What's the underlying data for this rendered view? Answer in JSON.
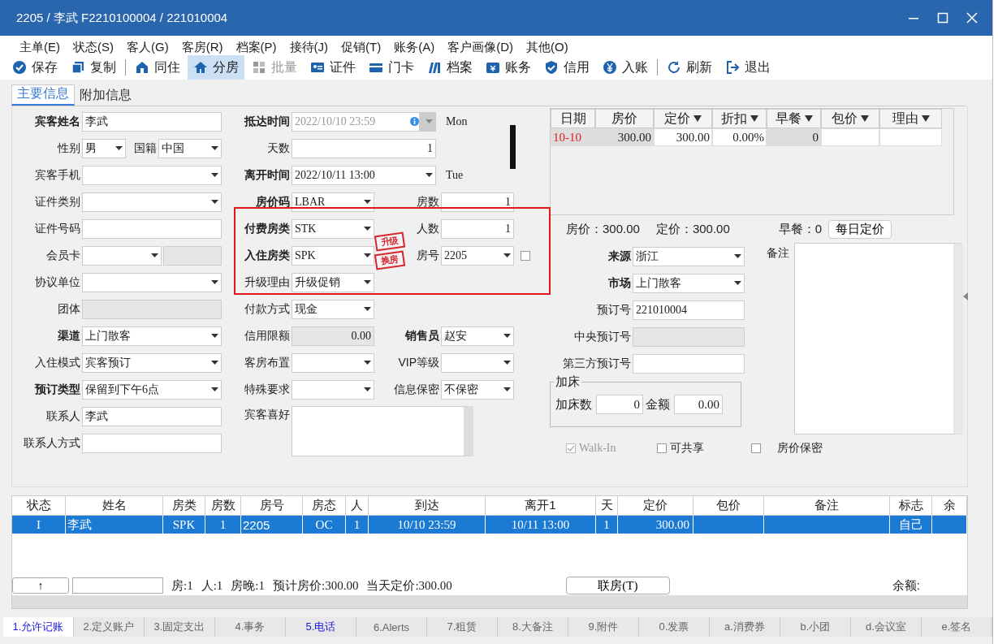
{
  "window": {
    "title": "2205 / 李武 F2210100004 / 221010004"
  },
  "menu": [
    "主单(E)",
    "状态(S)",
    "客人(G)",
    "客房(R)",
    "档案(P)",
    "接待(J)",
    "促销(T)",
    "账务(A)",
    "客户画像(D)",
    "其他(O)"
  ],
  "toolbar": [
    {
      "kind": "button",
      "label": "保存",
      "selected": false,
      "disabled": false
    },
    {
      "kind": "button",
      "label": "复制",
      "selected": false,
      "disabled": false
    },
    {
      "kind": "separator"
    },
    {
      "kind": "button",
      "label": "同住",
      "selected": false,
      "disabled": false
    },
    {
      "kind": "button",
      "label": "分房",
      "selected": true,
      "disabled": false
    },
    {
      "kind": "button",
      "label": "批量",
      "selected": false,
      "disabled": true
    },
    {
      "kind": "button",
      "label": "证件",
      "selected": false,
      "disabled": false
    },
    {
      "kind": "button",
      "label": "门卡",
      "selected": false,
      "disabled": false
    },
    {
      "kind": "button",
      "label": "档案",
      "selected": false,
      "disabled": false
    },
    {
      "kind": "button",
      "label": "账务",
      "selected": false,
      "disabled": false
    },
    {
      "kind": "button",
      "label": "信用",
      "selected": false,
      "disabled": false
    },
    {
      "kind": "button",
      "label": "入账",
      "selected": false,
      "disabled": false
    },
    {
      "kind": "separator"
    },
    {
      "kind": "button",
      "label": "刷新",
      "selected": false,
      "disabled": false
    },
    {
      "kind": "button",
      "label": "退出",
      "selected": false,
      "disabled": false
    }
  ],
  "tabs": [
    {
      "label": "主要信息",
      "selected": true
    },
    {
      "label": "附加信息",
      "selected": false
    }
  ],
  "form": {
    "column_1": [
      {
        "label": "宾客姓名",
        "value": "李武",
        "kind": "text",
        "bold": true
      },
      {
        "kind": "pair",
        "fields": [
          {
            "label": "性别",
            "value": "男",
            "kind": "select",
            "bold": false
          },
          {
            "label": "国籍",
            "value": "中国",
            "kind": "select",
            "bold": false
          }
        ]
      },
      {
        "label": "宾客手机",
        "kind": "select",
        "bold": false
      },
      {
        "label": "证件类别",
        "kind": "select",
        "bold": false
      },
      {
        "label": "证件号码",
        "kind": "text",
        "bold": false
      },
      {
        "label": "会员卡",
        "kind": "select_extra",
        "bold": false
      },
      {
        "label": "协议单位",
        "kind": "select",
        "bold": false
      },
      {
        "label": "团体",
        "kind": "readonly",
        "bold": false
      },
      {
        "label": "渠道",
        "value": "上门散客",
        "kind": "select",
        "bold": true
      },
      {
        "label": "入住模式",
        "value": "宾客预订",
        "kind": "select",
        "bold": false
      },
      {
        "label": "预订类型",
        "value": "保留到下午6点",
        "kind": "select",
        "bold": true
      },
      {
        "label": "联系人",
        "value": "李武",
        "kind": "text",
        "bold": false
      },
      {
        "label": "联系人方式",
        "kind": "text",
        "bold": false
      }
    ],
    "column_2": [
      {
        "label": "抵达时间",
        "value": "2022/10/10 23:59",
        "kind": "datetime",
        "day": "Mon",
        "disabled": true,
        "bold": true
      },
      {
        "label": "天数",
        "value": "1",
        "kind": "wide_number",
        "bold": false
      },
      {
        "label": "离开时间",
        "value": "2022/10/11 13:00",
        "kind": "datetime",
        "day": "Tue",
        "disabled": false,
        "bold": true
      },
      {
        "label": "房价码",
        "value": "LBAR",
        "kind": "select",
        "bold": true
      },
      {
        "label": "付费房类",
        "value": "STK",
        "kind": "select",
        "bold": true
      },
      {
        "label": "入住房类",
        "value": "SPK",
        "kind": "select",
        "bold": true
      },
      {
        "label": "升级理由",
        "value": "升级促销",
        "kind": "select",
        "bold": false
      },
      {
        "label": "付款方式",
        "value": "现金",
        "kind": "select",
        "bold": false
      },
      {
        "label": "信用限额",
        "value": "0.00",
        "kind": "readonly_number",
        "bold": false
      },
      {
        "label": "客房布置",
        "kind": "select",
        "bold": false
      },
      {
        "label": "特殊要求",
        "kind": "select",
        "bold": false
      },
      {
        "label": "宾客喜好",
        "kind": "textarea",
        "bold": false
      }
    ],
    "column_3": [
      {
        "label": "房数",
        "value": "1",
        "kind": "number",
        "bold": false
      },
      {
        "label": "人数",
        "value": "1",
        "kind": "number",
        "bold": false
      },
      {
        "label": "房号",
        "value": "2205",
        "kind": "select_check",
        "checked": false,
        "bold": false
      },
      {
        "label": "销售员",
        "value": "赵安",
        "kind": "select",
        "bold": true
      },
      {
        "label": "VIP等级",
        "kind": "select",
        "bold": false
      },
      {
        "label": "信息保密",
        "value": "不保密",
        "kind": "select",
        "bold": false
      }
    ],
    "stamps": [
      "升级",
      "换房"
    ]
  },
  "rate_table": {
    "columns": [
      {
        "label": "日期",
        "filter": false
      },
      {
        "label": "房价",
        "filter": false
      },
      {
        "label": "定价",
        "filter": true
      },
      {
        "label": "折扣",
        "filter": true
      },
      {
        "label": "早餐",
        "filter": true
      },
      {
        "label": "包价",
        "filter": true
      },
      {
        "label": "理由",
        "filter": true
      }
    ],
    "rows": [
      {
        "cells": [
          "10-10",
          "300.00",
          "300.00",
          "0.00%",
          "0",
          null,
          null
        ]
      }
    ]
  },
  "rate_summary": [
    "房价：300.00",
    "定价：300.00",
    "早餐：0"
  ],
  "daily_rate_button": "每日定价",
  "side_form": [
    {
      "label": "来源",
      "value": "浙江",
      "kind": "select",
      "bold": true
    },
    {
      "label": "市场",
      "value": "上门散客",
      "kind": "select",
      "bold": true
    },
    {
      "label": "预订号",
      "value": "221010004",
      "kind": "text",
      "bold": false
    },
    {
      "label": "中央预订号",
      "kind": "readonly",
      "bold": false
    },
    {
      "label": "第三方预订号",
      "kind": "text",
      "bold": false
    }
  ],
  "remarks": {
    "label": "备注"
  },
  "extra_bed": {
    "title": "加床",
    "count_label": "加床数",
    "count": "0",
    "amount_label": "金额",
    "amount": "0.00"
  },
  "checkboxes": [
    {
      "label": "Walk-In",
      "checked": true,
      "disabled": true
    },
    {
      "label": "可共享",
      "checked": false,
      "disabled": false
    },
    {
      "label": "房价保密",
      "checked": false,
      "disabled": false
    }
  ],
  "guest_table": {
    "columns": [
      "状态",
      "姓名",
      "房类",
      "房数",
      "房号",
      "房态",
      "人",
      "到达",
      "离开1",
      "天",
      "定价",
      "包价",
      "备注",
      "标志",
      "余"
    ],
    "rows": [
      {
        "selected": true,
        "cells": [
          "I",
          "李武",
          "SPK",
          "1",
          "2205",
          "OC",
          "1",
          "10/10 23:59",
          "10/11 13:00",
          "1",
          "300.00",
          null,
          null,
          "自己",
          null
        ]
      }
    ]
  },
  "footer": {
    "up_button": "↑",
    "stats": [
      "房:1",
      "人:1",
      "房晚:1",
      "预计房价:300.00",
      "当天定价:300.00"
    ],
    "link_button": "联房(T)",
    "balance_label": "余额:"
  },
  "bottom_tabs": [
    {
      "label": "1.允许记账",
      "selected": true,
      "highlighted": true
    },
    {
      "label": "2.定义账户",
      "selected": false,
      "highlighted": false
    },
    {
      "label": "3.固定支出",
      "selected": false,
      "highlighted": false
    },
    {
      "label": "4.事务",
      "selected": false,
      "highlighted": false
    },
    {
      "label": "5.电话",
      "selected": false,
      "highlighted": true
    },
    {
      "label": "6.Alerts",
      "selected": false,
      "highlighted": false
    },
    {
      "label": "7.租赁",
      "selected": false,
      "highlighted": false
    },
    {
      "label": "8.大备注",
      "selected": false,
      "highlighted": false
    },
    {
      "label": "9.附件",
      "selected": false,
      "highlighted": false
    },
    {
      "label": "0.发票",
      "selected": false,
      "highlighted": false
    },
    {
      "label": "a.消费券",
      "selected": false,
      "highlighted": false
    },
    {
      "label": "b.小团",
      "selected": false,
      "highlighted": false
    },
    {
      "label": "d.会议室",
      "selected": false,
      "highlighted": false
    },
    {
      "label": "e.签名",
      "selected": false,
      "highlighted": false
    }
  ]
}
